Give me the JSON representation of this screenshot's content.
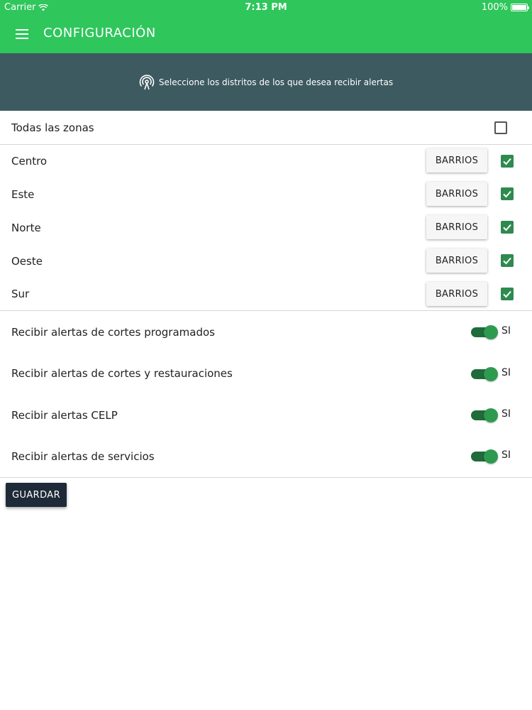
{
  "status_bar": {
    "carrier": "Carrier",
    "time": "7:13 PM",
    "battery": "100%"
  },
  "header": {
    "title": "CONFIGURACIÓN",
    "menu_icon": "hamburger-menu-icon"
  },
  "banner": {
    "text": "Seleccione los distritos de los que desea recibir alertas",
    "icon": "antenna-icon"
  },
  "all_zones": {
    "label": "Todas las zonas",
    "checked": false
  },
  "districts": [
    {
      "label": "Centro",
      "button": "BARRIOS",
      "checked": true
    },
    {
      "label": "Este",
      "button": "BARRIOS",
      "checked": true
    },
    {
      "label": "Norte",
      "button": "BARRIOS",
      "checked": true
    },
    {
      "label": "Oeste",
      "button": "BARRIOS",
      "checked": true
    },
    {
      "label": "Sur",
      "button": "BARRIOS",
      "checked": true
    }
  ],
  "alerts": [
    {
      "label": "Recibir alertas de cortes programados",
      "state": "SI",
      "on": true
    },
    {
      "label": "Recibir alertas de cortes y restauraciones",
      "state": "SI",
      "on": true
    },
    {
      "label": "Recibir alertas CELP",
      "state": "SI",
      "on": true
    },
    {
      "label": "Recibir alertas de servicios",
      "state": "SI",
      "on": true
    }
  ],
  "save_button": "GUARDAR",
  "colors": {
    "header": "#2fc65c",
    "banner": "#3c5a60",
    "checkbox": "#2e8a4f",
    "toggle": "#2e9a4f",
    "save_button": "#1e2a38"
  }
}
